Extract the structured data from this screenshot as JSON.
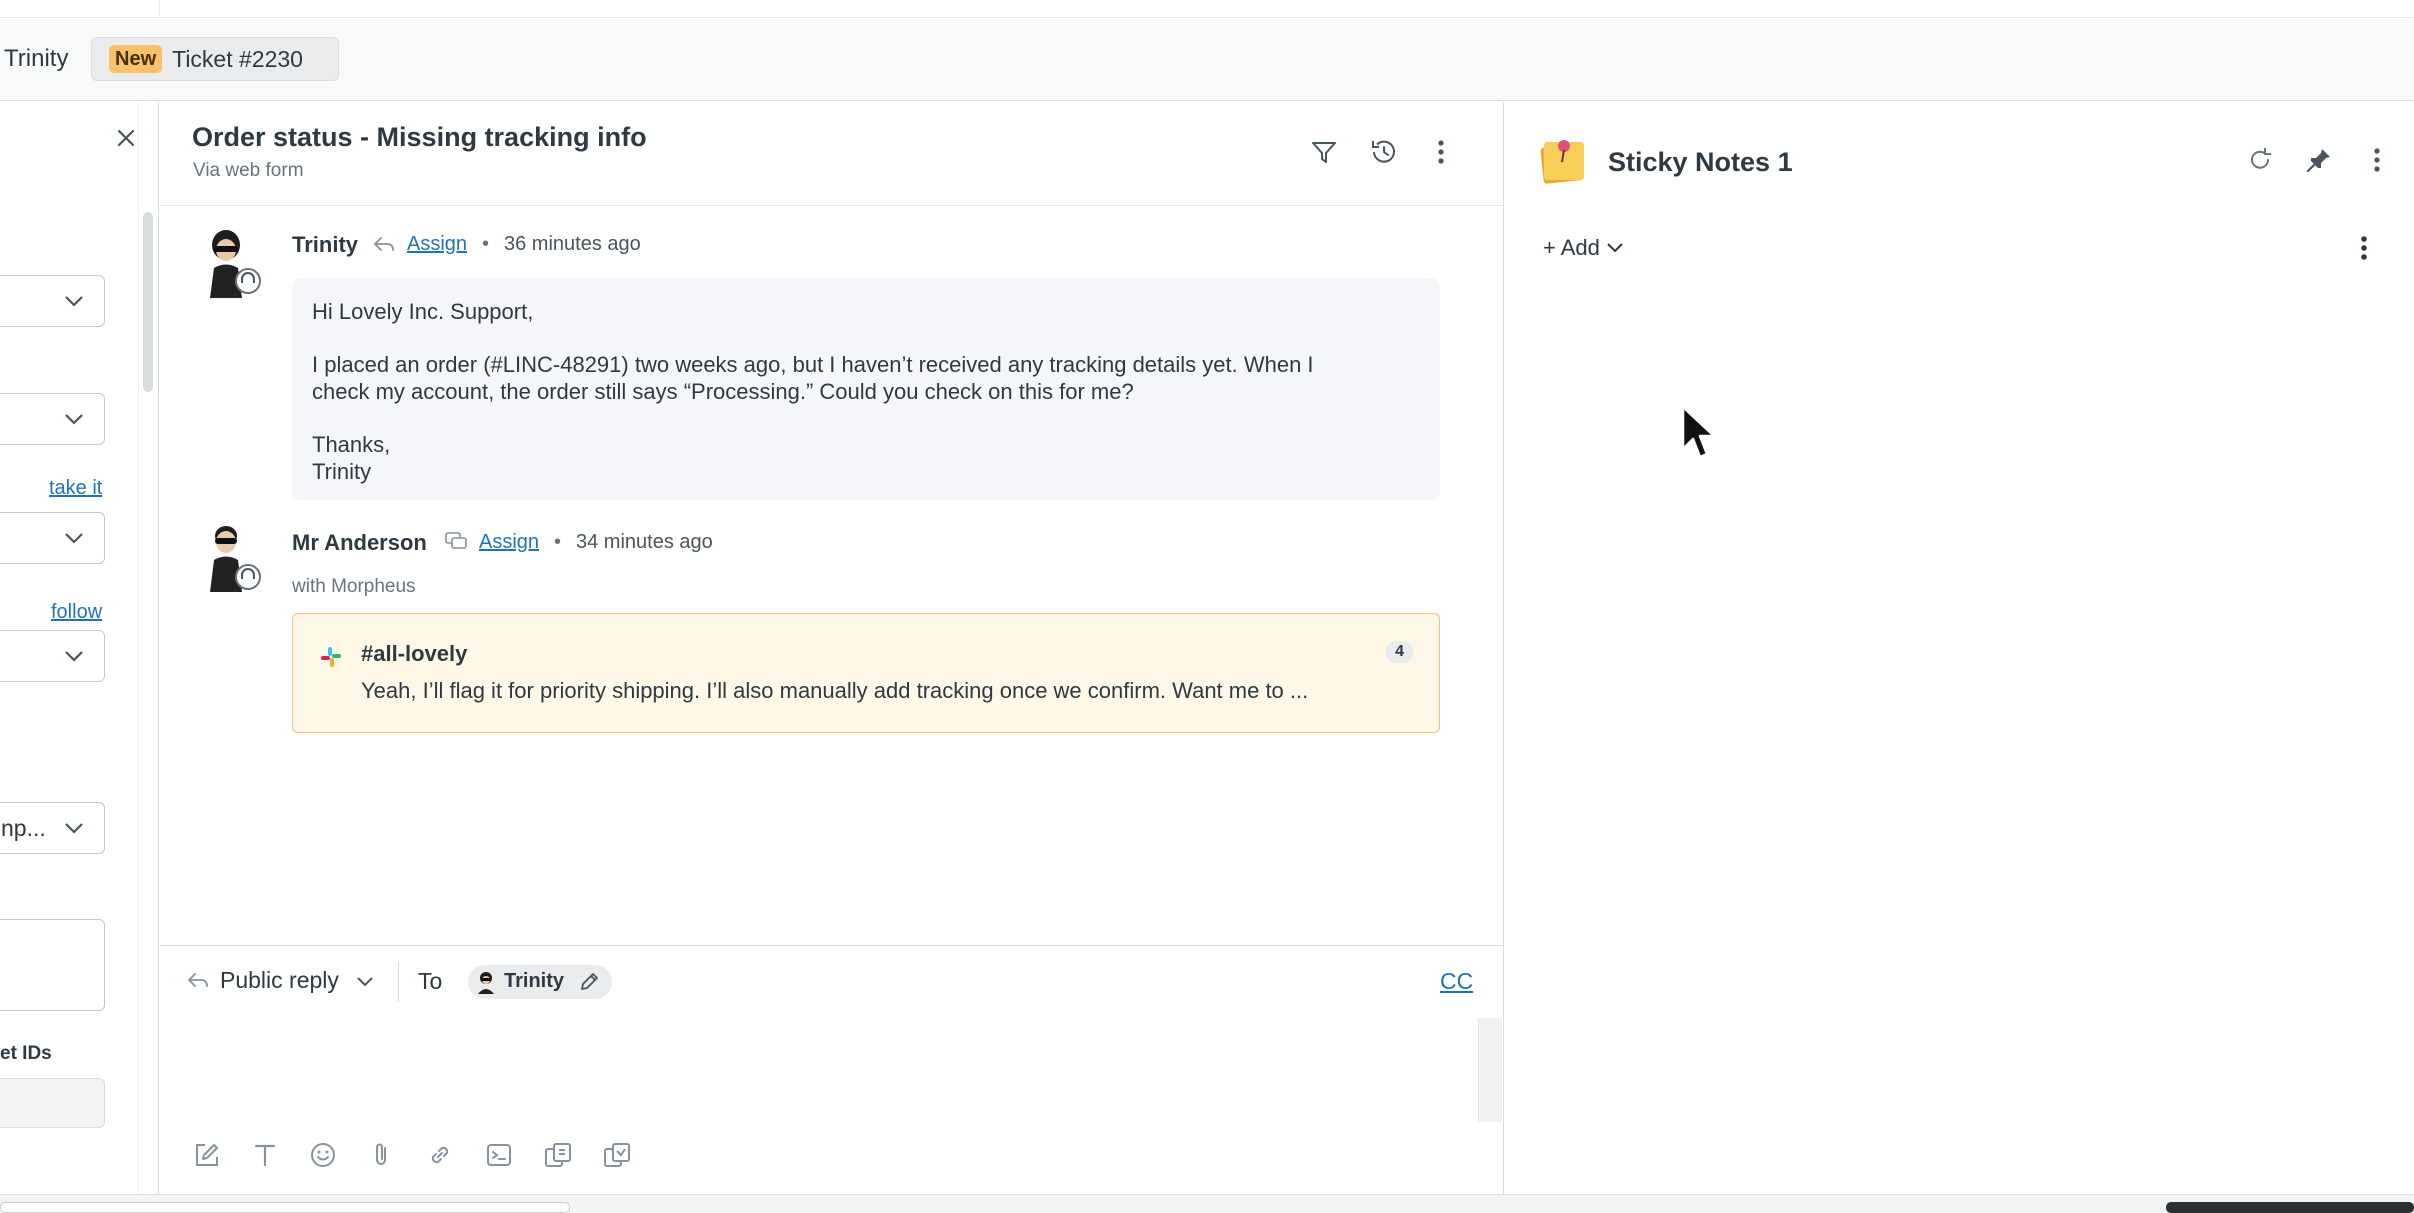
{
  "tabs": {
    "previous_tab_label": "Trinity",
    "active_tab": {
      "badge": "New",
      "title": "Ticket #2230"
    }
  },
  "left_panel": {
    "take_it_link": "take it",
    "follow_link": "follow",
    "truncated_select_value": "np...",
    "ticket_ids_label": "et IDs"
  },
  "ticket": {
    "subject": "Order status - Missing tracking info",
    "via": "Via web form"
  },
  "conversation": [
    {
      "author": "Trinity",
      "assign_label": "Assign",
      "separator": "•",
      "timestamp": "36 minutes ago",
      "body": {
        "greeting": "Hi Lovely Inc. Support,",
        "line1": "I placed an order (#LINC-48291) two weeks ago, but I haven’t received any tracking details yet. When I",
        "line2": "check my account, the order still says “Processing.” Could you check on this for me?",
        "signoff": "Thanks,",
        "signature": "Trinity"
      }
    },
    {
      "author": "Mr Anderson",
      "assign_label": "Assign",
      "separator": "•",
      "timestamp": "34 minutes ago",
      "with_label": "with Morpheus",
      "slack": {
        "channel": "#all-lovely",
        "preview": "Yeah, I’ll flag it for priority shipping. I’ll also manually add tracking once we confirm. Want me to ...",
        "count": "4"
      }
    }
  ],
  "composer": {
    "reply_type": "Public reply",
    "to_label": "To",
    "recipient": "Trinity",
    "cc_label": "CC"
  },
  "right_panel": {
    "app_title": "Sticky Notes 1",
    "add_label": "+ Add"
  },
  "colors": {
    "link_blue": "#1f73b7",
    "new_badge": "#f6c16a",
    "slack_card_bg": "#fff8e6",
    "slack_card_border": "#f2c27a",
    "message_bubble": "#f5f6fa"
  },
  "icons": {
    "close": "close-icon",
    "filter": "filter-icon",
    "history": "history-icon",
    "more": "more-vertical-icon",
    "reply": "reply-arrow-icon",
    "internal_note": "internal-note-icon",
    "slack": "slack-icon",
    "refresh": "refresh-icon",
    "pin": "pin-icon",
    "sticky_note": "sticky-note-icon",
    "pencil": "pencil-icon",
    "cursor": "mouse-pointer-icon"
  }
}
